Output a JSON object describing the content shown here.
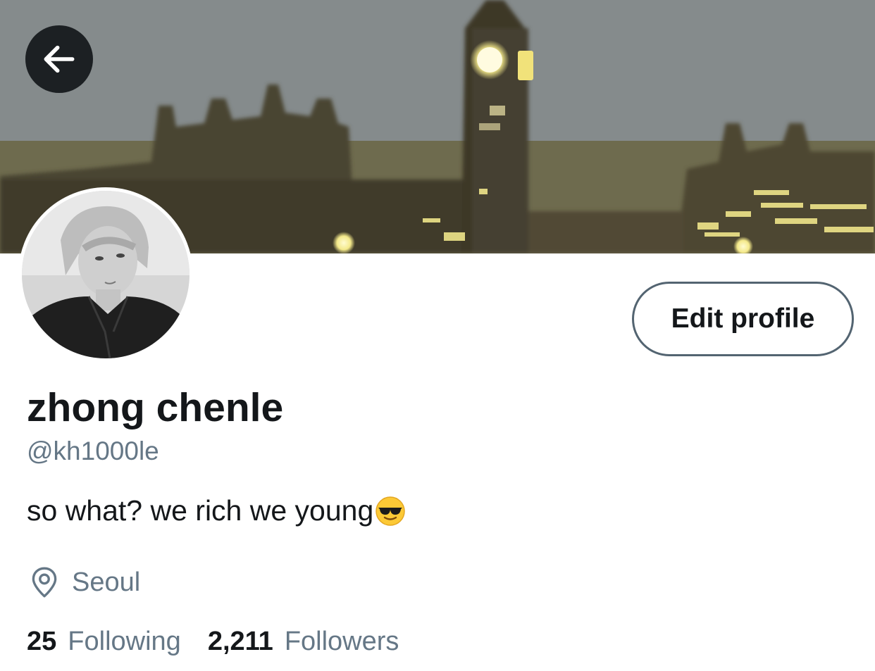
{
  "header": {
    "back_icon": "arrow-left-icon",
    "banner_description_icon": "banner-image"
  },
  "profile": {
    "display_name": "zhong chenle",
    "handle": "@kh1000le",
    "bio": "so what? we rich we young",
    "bio_emoji": "smiling-face-with-sunglasses-emoji",
    "location_icon": "location-pin-icon",
    "location": "Seoul",
    "edit_button_label": "Edit profile"
  },
  "stats": {
    "following_count": "25",
    "following_label": "Following",
    "followers_count": "2,211",
    "followers_label": "Followers"
  },
  "colors": {
    "text_primary": "#14171a",
    "text_secondary": "#657786",
    "button_border": "#536471"
  }
}
